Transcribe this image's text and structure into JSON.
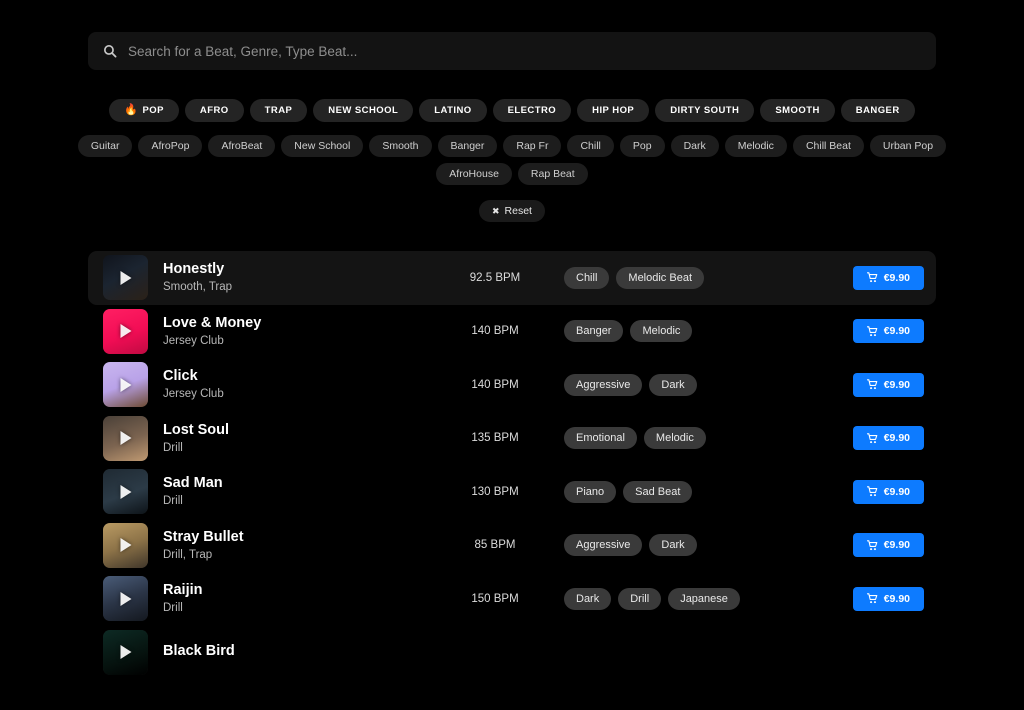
{
  "search": {
    "placeholder": "Search for a Beat, Genre, Type Beat...",
    "value": "",
    "icon": "search-icon"
  },
  "genres": [
    {
      "label": "POP",
      "emoji": "🔥"
    },
    {
      "label": "AFRO",
      "emoji": ""
    },
    {
      "label": "TRAP",
      "emoji": ""
    },
    {
      "label": "NEW SCHOOL",
      "emoji": ""
    },
    {
      "label": "LATINO",
      "emoji": ""
    },
    {
      "label": "ELECTRO",
      "emoji": ""
    },
    {
      "label": "HIP HOP",
      "emoji": ""
    },
    {
      "label": "DIRTY SOUTH",
      "emoji": ""
    },
    {
      "label": "SMOOTH",
      "emoji": ""
    },
    {
      "label": "BANGER",
      "emoji": ""
    }
  ],
  "subtag_rows": [
    [
      "Guitar",
      "AfroPop",
      "AfroBeat",
      "New School",
      "Smooth",
      "Banger",
      "Rap Fr",
      "Chill",
      "Pop",
      "Dark",
      "Melodic",
      "Chill Beat",
      "Urban Pop"
    ],
    [
      "AfroHouse",
      "Rap Beat"
    ]
  ],
  "reset": {
    "label": "Reset",
    "icon": "close-icon",
    "glyph": "✖"
  },
  "colors": {
    "accent_blue": "#0d7bff",
    "background": "#000000",
    "row_active": "#141414",
    "genre_pill": "#242424",
    "subtag_pill": "#1d1d1d",
    "track_tag": "#3a3a3a"
  },
  "buy": {
    "price": "€9.90",
    "icon": "cart-icon"
  },
  "tracks": [
    {
      "title": "Honestly",
      "subtitle": "Smooth, Trap",
      "bpm": "92.5 BPM",
      "tags": [
        "Chill",
        "Melodic Beat"
      ],
      "price": "€9.90",
      "active": true,
      "art": "linear-gradient(150deg,#10141c 0%,#1b2430 45%,#2b2118 100%)"
    },
    {
      "title": "Love & Money",
      "subtitle": "Jersey Club",
      "bpm": "140 BPM",
      "tags": [
        "Banger",
        "Melodic"
      ],
      "price": "€9.90",
      "active": false,
      "art": "linear-gradient(160deg,#ff1f63 0%,#f20d55 55%,#c00a42 100%)"
    },
    {
      "title": "Click",
      "subtitle": "Jersey Club",
      "bpm": "140 BPM",
      "tags": [
        "Aggressive",
        "Dark"
      ],
      "price": "€9.90",
      "active": false,
      "art": "linear-gradient(160deg,#c9b6ef 0%,#b9a2e8 50%,#6d4a32 100%)"
    },
    {
      "title": "Lost Soul",
      "subtitle": "Drill",
      "bpm": "135 BPM",
      "tags": [
        "Emotional",
        "Melodic"
      ],
      "price": "€9.90",
      "active": false,
      "art": "linear-gradient(160deg,#4a4038 0%,#7c6450 55%,#c09a72 100%)"
    },
    {
      "title": "Sad Man",
      "subtitle": "Drill",
      "bpm": "130 BPM",
      "tags": [
        "Piano",
        "Sad Beat"
      ],
      "price": "€9.90",
      "active": false,
      "art": "linear-gradient(160deg,#1f2a33 0%,#2c3b47 55%,#0d1318 100%)"
    },
    {
      "title": "Stray Bullet",
      "subtitle": "Drill, Trap",
      "bpm": "85 BPM",
      "tags": [
        "Aggressive",
        "Dark"
      ],
      "price": "€9.90",
      "active": false,
      "art": "linear-gradient(160deg,#b99a63 0%,#8d7348 50%,#40362a 100%)"
    },
    {
      "title": "Raijin",
      "subtitle": "Drill",
      "bpm": "150 BPM",
      "tags": [
        "Dark",
        "Drill",
        "Japanese"
      ],
      "price": "€9.90",
      "active": false,
      "art": "linear-gradient(160deg,#4a5c78 0%,#2b3547 50%,#14181f 100%)"
    },
    {
      "title": "Black Bird",
      "subtitle": "",
      "bpm": "",
      "tags": [
        "",
        ""
      ],
      "price": "",
      "active": false,
      "art": "linear-gradient(160deg,#0d2a24 0%,#06130f 60%,#000000 100%)"
    }
  ]
}
